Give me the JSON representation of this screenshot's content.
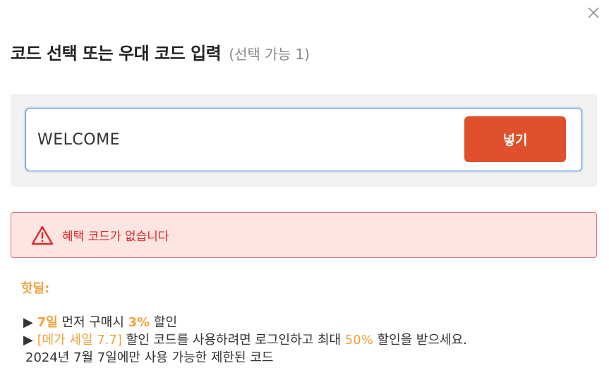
{
  "dialog": {
    "title": "코드 선택 또는 우대 코드 입력",
    "subtitle": "(선택 가능 1)",
    "close_icon": "close-icon"
  },
  "code_entry": {
    "value": "WELCOME",
    "apply_label": "넣기"
  },
  "error": {
    "icon": "warning-icon",
    "message": "혜택 코드가 없습니다"
  },
  "hot_deals": {
    "label": "핫딜:",
    "deal1": {
      "bullet": "▶",
      "days": "7일",
      "text1": " 먼저 구매시 ",
      "percent": "3%",
      "text2": " 할인"
    },
    "deal2": {
      "bullet": "▶",
      "code": "[메가 세일 7.7]",
      "text1": " 할인 코드를 사용하려면 로그인하고 최대 ",
      "percent": "50%",
      "text2": " 할인을 받으세요."
    },
    "deal2_note": "2024년 7월 7일에만 사용 가능한 제한된 코드"
  },
  "colors": {
    "accent": "#e0502c",
    "highlight": "#f2a23c",
    "error_text": "#e3262b",
    "error_bg": "#fde5e2",
    "input_border": "#4a90d9"
  }
}
